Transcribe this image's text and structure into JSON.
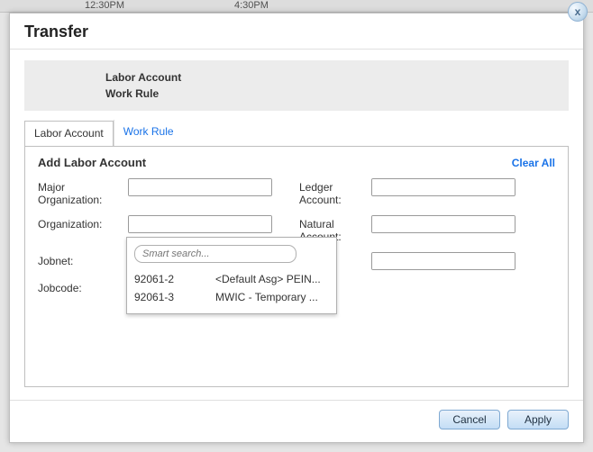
{
  "bg": {
    "time1": "12:30PM",
    "time2": "4:30PM"
  },
  "dialog": {
    "title": "Transfer",
    "close": "x",
    "info": {
      "line1": "Labor Account",
      "line2": "Work Rule"
    },
    "tabs": {
      "labor": "Labor Account",
      "workrule": "Work Rule"
    }
  },
  "panel": {
    "title": "Add Labor Account",
    "clear": "Clear All",
    "labels": {
      "major_org": "Major Organization:",
      "organization": "Organization:",
      "jobnet": "Jobnet:",
      "jobcode": "Jobcode:",
      "ledger": "Ledger Account:",
      "natural": "Natural Account:"
    },
    "values": {
      "major_org": "",
      "organization": "",
      "jobnet": "",
      "jobcode": "",
      "ledger": "",
      "natural": "",
      "blank": ""
    }
  },
  "dropdown": {
    "placeholder": "Smart search...",
    "options": [
      {
        "code": "92061-2",
        "desc": "<Default Asg> PEIN..."
      },
      {
        "code": "92061-3",
        "desc": "MWIC - Temporary ..."
      }
    ]
  },
  "footer": {
    "cancel": "Cancel",
    "apply": "Apply"
  }
}
